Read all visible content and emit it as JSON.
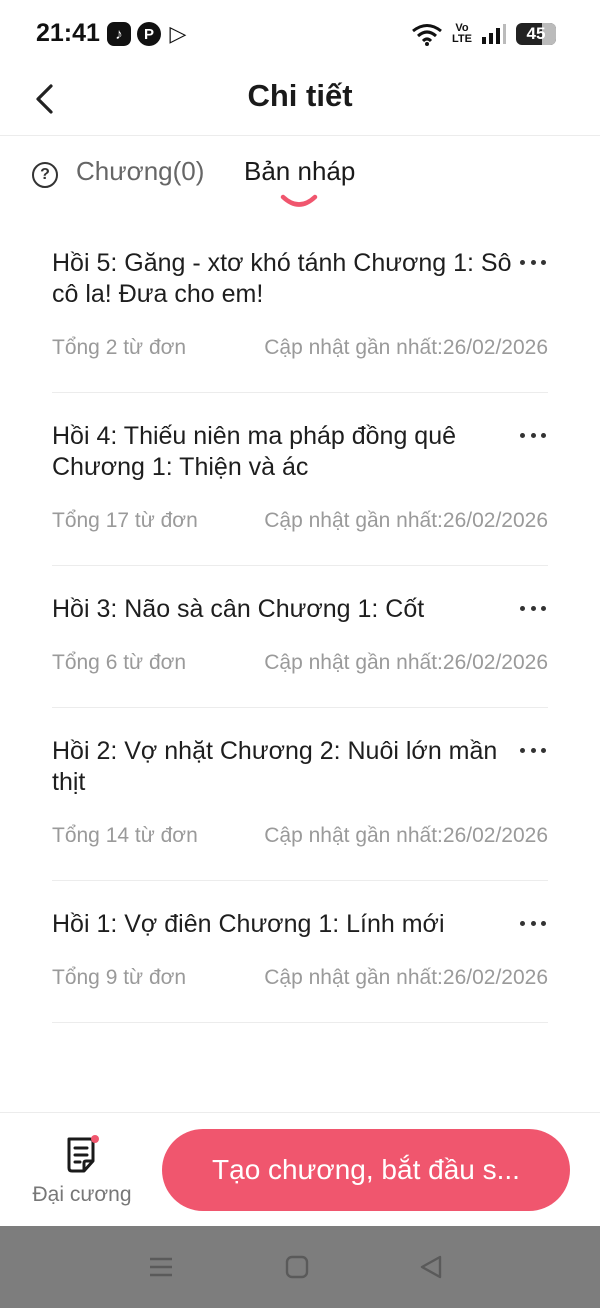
{
  "status_bar": {
    "time": "21:41",
    "apps": [
      "tiktok-icon",
      "pinterest-icon",
      "play-store-icon"
    ],
    "volte_top": "Vo",
    "volte_bottom": "LTE",
    "battery": "45"
  },
  "header": {
    "title": "Chi tiết"
  },
  "tabs": [
    {
      "label": "Chương(0)",
      "active": false
    },
    {
      "label": "Bản nháp",
      "active": true
    }
  ],
  "drafts": [
    {
      "title": "Hồi 5: Găng - xtơ khó tánh Chương 1: Sô cô la! Đưa cho em!",
      "words": "Tổng 2 từ đơn",
      "updated": "Cập nhật gần nhất:26/02/2026"
    },
    {
      "title": "Hồi 4: Thiếu niên ma pháp đồng quê Chương 1: Thiện và ác",
      "words": "Tổng 17 từ đơn",
      "updated": "Cập nhật gần nhất:26/02/2026"
    },
    {
      "title": "Hồi 3: Não sà cân Chương 1: Cốt",
      "words": "Tổng 6 từ đơn",
      "updated": "Cập nhật gần nhất:26/02/2026"
    },
    {
      "title": "Hồi 2: Vợ nhặt Chương 2: Nuôi lớn mần thịt",
      "words": "Tổng 14 từ đơn",
      "updated": "Cập nhật gần nhất:26/02/2026"
    },
    {
      "title": "Hồi 1: Vợ điên Chương 1: Lính mới",
      "words": "Tổng 9 từ đơn",
      "updated": "Cập nhật gần nhất:26/02/2026"
    }
  ],
  "bottom": {
    "outline_label": "Đại cương",
    "create_label": "Tạo chương, bắt đầu s..."
  },
  "colors": {
    "accent": "#f0566e",
    "muted_text": "#9a9a9a",
    "nav_bar": "#7d7d7d"
  }
}
